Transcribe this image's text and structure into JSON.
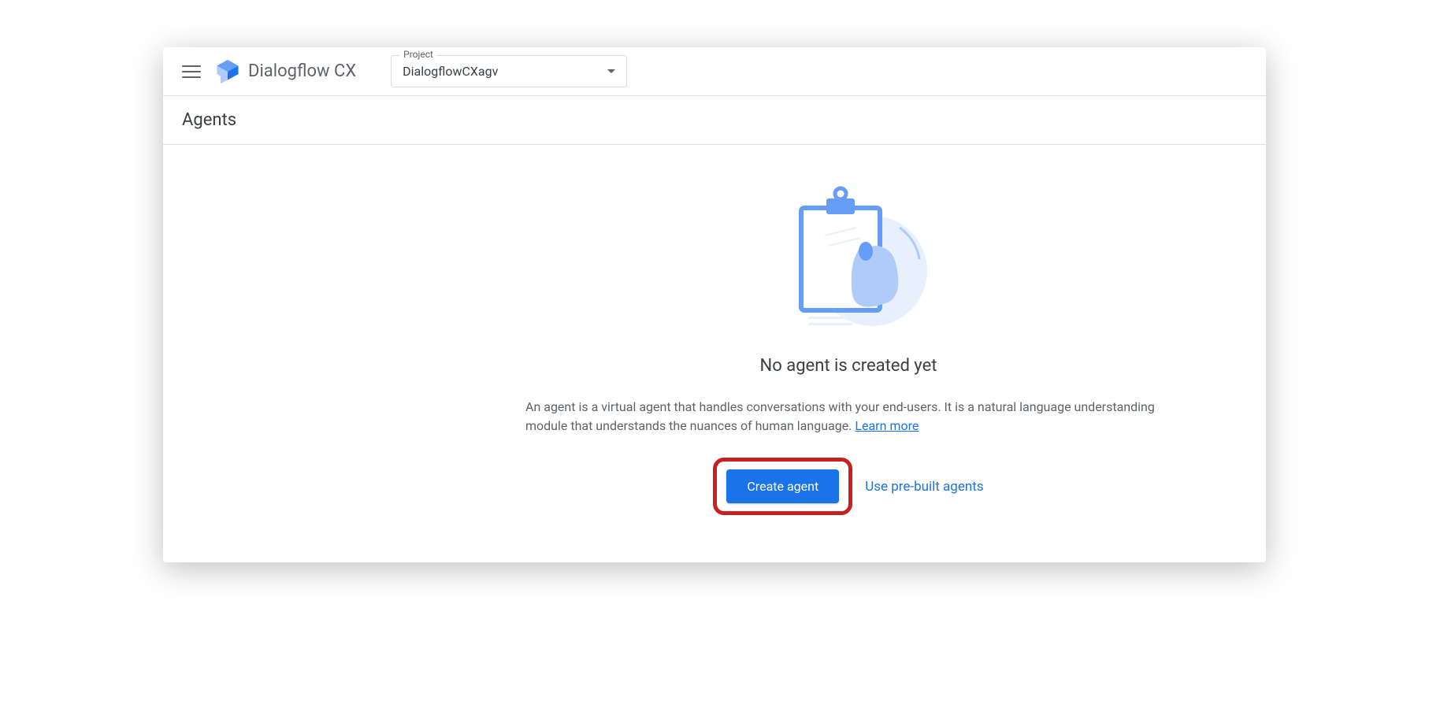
{
  "header": {
    "product_name": "Dialogflow CX",
    "project_selector": {
      "label": "Project",
      "value": "DialogflowCXagv"
    }
  },
  "subheader": {
    "title": "Agents"
  },
  "empty_state": {
    "title": "No agent is created yet",
    "description": "An agent is a virtual agent that handles conversations with your end-users. It is a natural language understanding module that understands the nuances of human language. ",
    "learn_more": "Learn more",
    "create_button": "Create agent",
    "prebuilt_link": "Use pre-built agents"
  }
}
